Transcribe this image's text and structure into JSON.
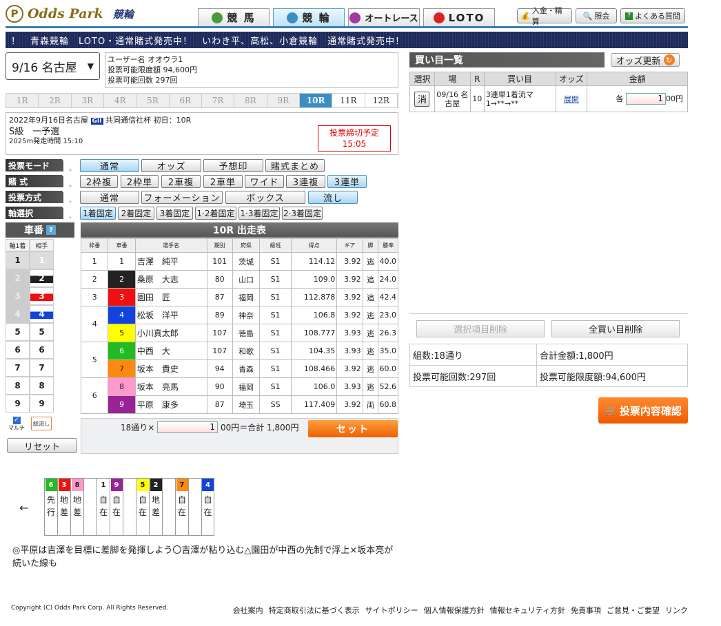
{
  "header": {
    "logo_text": "Odds Park",
    "logo_sub": "競輪",
    "tabs": [
      {
        "label": "競 馬"
      },
      {
        "label": "競 輪"
      },
      {
        "label": "オートレース"
      },
      {
        "label": "LOTO"
      }
    ],
    "buttons": {
      "deposit": "入金・精算",
      "inquiry": "照会",
      "faq": "よくある質問"
    }
  },
  "ticker": "！　青森競輪　LOTO・通常賭式発売中！　いわき平、高松、小倉競輪　通常賭式発売中！",
  "venue_select": "9/16 名古屋",
  "user": {
    "name": "ユーザー名 オオウラ1",
    "limit": "投票可能限度額 94,600円",
    "count": "投票可能回数 297回"
  },
  "race_tabs": [
    "1R",
    "2R",
    "3R",
    "4R",
    "5R",
    "6R",
    "7R",
    "8R",
    "9R",
    "10R",
    "11R",
    "12R"
  ],
  "race_info": {
    "date_venue": "2022年9月16日名古屋",
    "grade": "GII",
    "title": "共同通信社杯 初日：10R",
    "class": "S級　一予選",
    "distance": "2025m発走時間 15:10",
    "deadline_label": "投票締切予定",
    "deadline_time": "15:05"
  },
  "modes": {
    "mode_label": "投票モード",
    "mode_options": [
      "通常",
      "オッズ",
      "予想印",
      "賭式まとめ"
    ],
    "bet_label": "賭 式",
    "bet_options": [
      "2枠複",
      "2枠単",
      "2車複",
      "2車単",
      "ワイド",
      "3連複",
      "3連単"
    ],
    "method_label": "投票方式",
    "method_options": [
      "通常",
      "フォーメーション",
      "ボックス",
      "流し"
    ],
    "axis_label": "軸選択",
    "axis_options": [
      "1着固定",
      "2着固定",
      "3着固定",
      "1·2着固定",
      "1·3着固定",
      "2·3着固定"
    ],
    "q": "?"
  },
  "numpad": {
    "title": "車番",
    "col1": "軸1着",
    "col2": "相手",
    "rows": [
      "1",
      "2",
      "3",
      "4",
      "5",
      "6",
      "7",
      "8",
      "9"
    ],
    "multi": "マルチ",
    "all": "総流し",
    "reset": "リセット"
  },
  "entry": {
    "title": "10R 出走表",
    "headers": [
      "枠番",
      "車番",
      "選手名",
      "期別",
      "府県",
      "級班",
      "得点",
      "ギア",
      "脚",
      "勝率"
    ],
    "rows": [
      {
        "frame": "1",
        "num": "1",
        "name": "吉澤　純平",
        "term": "101",
        "pref": "茨城",
        "cls": "S1",
        "pts": "114.12",
        "gear": "3.92",
        "leg": "逃",
        "rate": "40.0"
      },
      {
        "frame": "2",
        "num": "2",
        "name": "桑原　大志",
        "term": "80",
        "pref": "山口",
        "cls": "S1",
        "pts": "109.0",
        "gear": "3.92",
        "leg": "追",
        "rate": "24.0"
      },
      {
        "frame": "3",
        "num": "3",
        "name": "園田　匠",
        "term": "87",
        "pref": "福岡",
        "cls": "S1",
        "pts": "112.878",
        "gear": "3.92",
        "leg": "追",
        "rate": "42.4"
      },
      {
        "frame": "4",
        "num": "4",
        "name": "松坂　洋平",
        "term": "89",
        "pref": "神奈",
        "cls": "S1",
        "pts": "106.8",
        "gear": "3.92",
        "leg": "逃",
        "rate": "23.0"
      },
      {
        "frame": "",
        "num": "5",
        "name": "小川真太郎",
        "term": "107",
        "pref": "徳島",
        "cls": "S1",
        "pts": "108.777",
        "gear": "3.93",
        "leg": "逃",
        "rate": "26.3"
      },
      {
        "frame": "5",
        "num": "6",
        "name": "中西　大",
        "term": "107",
        "pref": "和歌",
        "cls": "S1",
        "pts": "104.35",
        "gear": "3.93",
        "leg": "逃",
        "rate": "35.0"
      },
      {
        "frame": "",
        "num": "7",
        "name": "坂本　貴史",
        "term": "94",
        "pref": "青森",
        "cls": "S1",
        "pts": "108.466",
        "gear": "3.92",
        "leg": "逃",
        "rate": "60.0"
      },
      {
        "frame": "6",
        "num": "8",
        "name": "坂本　亮馬",
        "term": "90",
        "pref": "福岡",
        "cls": "S1",
        "pts": "106.0",
        "gear": "3.93",
        "leg": "逃",
        "rate": "52.6"
      },
      {
        "frame": "",
        "num": "9",
        "name": "平原　康多",
        "term": "87",
        "pref": "埼玉",
        "cls": "SS",
        "pts": "117.409",
        "gear": "3.92",
        "leg": "両",
        "rate": "60.8"
      }
    ]
  },
  "setbar": {
    "count": "18通り×",
    "unit": "1",
    "mid": "00円＝合計 1,800円",
    "button": "セット"
  },
  "lineup": {
    "arrow": "←",
    "cells": [
      {
        "n": "6",
        "s": "先行"
      },
      {
        "n": "3",
        "s": "地差"
      },
      {
        "n": "8",
        "s": "地差"
      },
      {
        "n": "",
        "s": ""
      },
      {
        "n": "1",
        "s": "自在"
      },
      {
        "n": "9",
        "s": "自在"
      },
      {
        "n": "",
        "s": ""
      },
      {
        "n": "5",
        "s": "自在"
      },
      {
        "n": "2",
        "s": "地差"
      },
      {
        "n": "",
        "s": ""
      },
      {
        "n": "7",
        "s": "自在"
      },
      {
        "n": "",
        "s": ""
      },
      {
        "n": "4",
        "s": "自在"
      }
    ]
  },
  "comment": "◎平原は吉澤を目標に差脚を発揮しよう〇吉澤が粘り込む△園田が中西の先制で浮上×坂本亮が続いた線も",
  "footer": {
    "copyright": "Copyright (C) Odds Park Corp. All Rights Reserved.",
    "links": [
      "会社案内",
      "特定商取引法に基づく表示",
      "サイトポリシー",
      "個人情報保護方針",
      "情報セキュリティ方針",
      "免責事項",
      "ご意見・ご要望",
      "リンク"
    ]
  },
  "basket": {
    "title": "買い目一覧",
    "odds_update": "オッズ更新",
    "headers": [
      "選択",
      "場",
      "R",
      "買い目",
      "オッズ",
      "金額"
    ],
    "row": {
      "del": "消",
      "venue": "09/16 名古屋",
      "r": "10",
      "bet": "3連単1着流マ 1→**→**",
      "odds": "展開",
      "each": "各",
      "amount": "1",
      "unit": "00円"
    },
    "del_selected": "選択項目削除",
    "del_all": "全買い目削除",
    "combos": "組数:18通り",
    "total": "合計金額:1,800円",
    "count": "投票可能回数:297回",
    "limit": "投票可能限度額:94,600円",
    "confirm": "投票内容確認"
  },
  "colors": {
    "car": [
      "#ffffff",
      "#222222",
      "#ee1111",
      "#1144dd",
      "#ffff00",
      "#22bb22",
      "#ff8811",
      "#ff99cc",
      "#992299"
    ],
    "car_text": [
      "#222",
      "#fff",
      "#fff",
      "#fff",
      "#222",
      "#fff",
      "#222",
      "#222",
      "#fff"
    ]
  }
}
